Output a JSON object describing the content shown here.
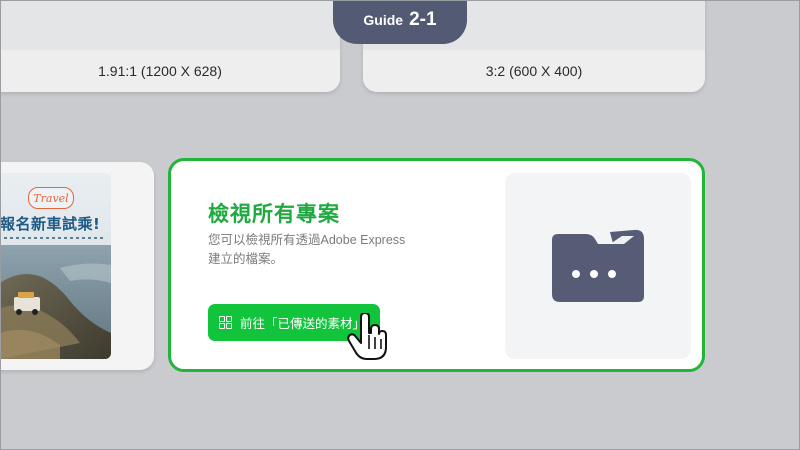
{
  "guide": {
    "word": "Guide",
    "number": "2-1"
  },
  "top_cards": [
    {
      "label": "1.91:1 (1200 X 628)"
    },
    {
      "label": "3:2 (600 X 400)"
    }
  ],
  "preview_card": {
    "badge": "Travel",
    "headline": "報名新車試乘!"
  },
  "main_card": {
    "title": "檢視所有專案",
    "description_line1": "您可以檢視所有透過Adobe Express",
    "description_line2": "建立的檔案。",
    "cta_label": "前往「已傳送的素材」",
    "cta_icon": "grid-icon",
    "illustration_icon": "folder-more-icon"
  },
  "colors": {
    "accent_green": "#21b539",
    "button_green": "#12c33c",
    "guide_pill": "#535a74",
    "folder": "#565c76"
  }
}
